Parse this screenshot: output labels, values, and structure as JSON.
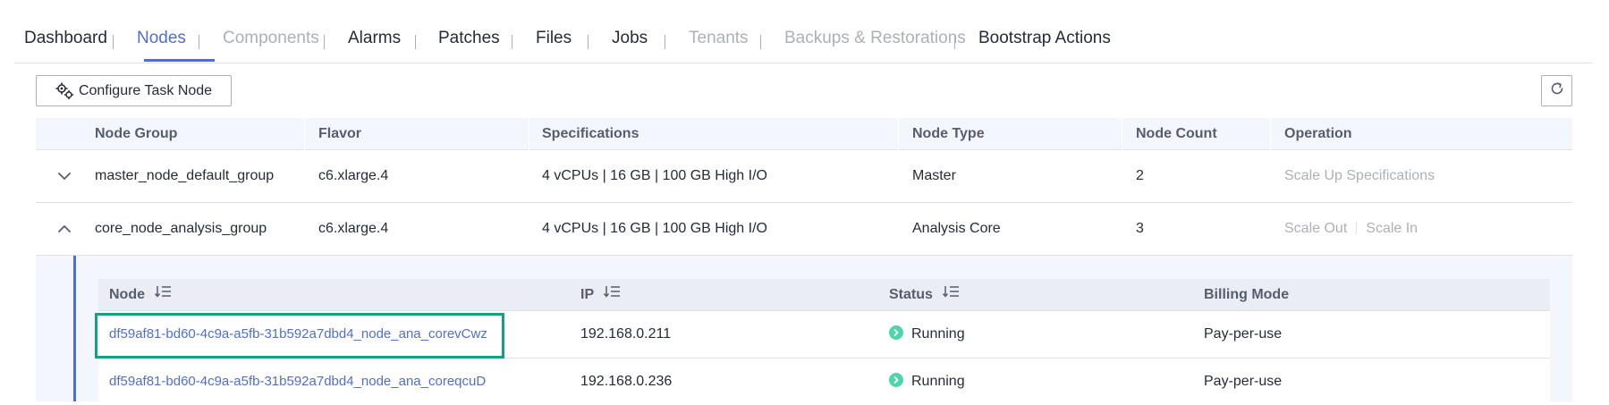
{
  "tabs": [
    {
      "label": "Dashboard",
      "state": "normal"
    },
    {
      "label": "Nodes",
      "state": "active"
    },
    {
      "label": "Components",
      "state": "disabled"
    },
    {
      "label": "Alarms",
      "state": "normal"
    },
    {
      "label": "Patches",
      "state": "normal"
    },
    {
      "label": "Files",
      "state": "normal"
    },
    {
      "label": "Jobs",
      "state": "normal"
    },
    {
      "label": "Tenants",
      "state": "disabled"
    },
    {
      "label": "Backups & Restorations",
      "state": "disabled"
    },
    {
      "label": "Bootstrap Actions",
      "state": "normal"
    }
  ],
  "toolbar": {
    "configure_label": "Configure Task Node",
    "configure_icon": "gear-icon",
    "refresh_icon": "refresh-icon"
  },
  "node_groups_table": {
    "headers": {
      "node_group": "Node Group",
      "flavor": "Flavor",
      "specifications": "Specifications",
      "node_type": "Node Type",
      "node_count": "Node Count",
      "operation": "Operation"
    },
    "rows": [
      {
        "expanded": false,
        "node_group": "master_node_default_group",
        "flavor": "c6.xlarge.4",
        "specifications": "4 vCPUs | 16 GB | 100 GB High I/O",
        "node_type": "Master",
        "node_count": "2",
        "operations": [
          "Scale Up Specifications"
        ]
      },
      {
        "expanded": true,
        "node_group": "core_node_analysis_group",
        "flavor": "c6.xlarge.4",
        "specifications": "4 vCPUs | 16 GB | 100 GB High I/O",
        "node_type": "Analysis Core",
        "node_count": "3",
        "operations": [
          "Scale Out",
          "Scale In"
        ]
      }
    ]
  },
  "nodes_table": {
    "headers": {
      "node": "Node",
      "ip": "IP",
      "status": "Status",
      "billing_mode": "Billing Mode"
    },
    "rows": [
      {
        "node": "df59af81-bd60-4c9a-a5fb-31b592a7dbd4_node_ana_corevCwz",
        "ip": "192.168.0.211",
        "status": "Running",
        "billing_mode": "Pay-per-use",
        "highlighted": true
      },
      {
        "node": "df59af81-bd60-4c9a-a5fb-31b592a7dbd4_node_ana_coreqcuD",
        "ip": "192.168.0.236",
        "status": "Running",
        "billing_mode": "Pay-per-use",
        "highlighted": false
      }
    ]
  },
  "colors": {
    "accent": "#526ecc",
    "disabled": "#adb0b8",
    "running": "#50d4ab",
    "highlight": "#159f85"
  }
}
